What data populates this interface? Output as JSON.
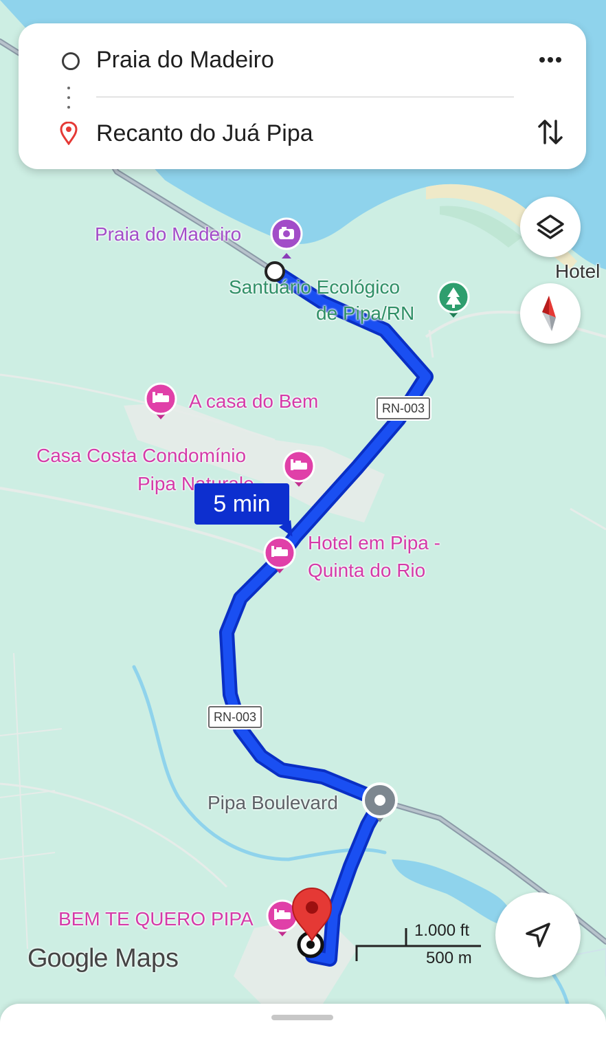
{
  "route": {
    "origin": "Praia do Madeiro",
    "destination": "Recanto do Juá Pipa",
    "eta": "5 min"
  },
  "map_labels": {
    "praia_do_madeiro": "Praia do Madeiro",
    "santuario_line1": "Santuário Ecológico",
    "santuario_line2": "de Pipa/RN",
    "hotel_edge": "Hotel",
    "a_casa_do_bem": "A casa do Bem",
    "casa_costa_line1": "Casa Costa Condomínio",
    "casa_costa_line2": "Pipa Naturale",
    "hotel_quinta_line1": "Hotel em Pipa -",
    "hotel_quinta_line2": "Quinta do Rio",
    "pipa_boulevard": "Pipa Boulevard",
    "bem_te_quero": "BEM TE QUERO PIPA"
  },
  "road_shields": {
    "north": "RN-003",
    "south": "RN-003"
  },
  "scale": {
    "feet": "1.000 ft",
    "meters": "500 m"
  },
  "branding": {
    "google": "Google",
    "maps": "Maps"
  },
  "icons": {
    "origin": "origin-circle-icon",
    "destination": "destination-pin-icon",
    "more": "more-options-icon",
    "swap": "swap-direction-icon",
    "layers": "layers-icon",
    "compass": "compass-icon",
    "navigate": "navigation-arrow-icon"
  },
  "colors": {
    "route": "#1a3fe0",
    "route_outline": "#0a2fc4",
    "water": "#8fd3ec",
    "land": "#cdeee3",
    "lodging": "#e040a8",
    "attraction": "#a24dc8",
    "park": "#2f9e6e",
    "pin": "#e53935"
  }
}
